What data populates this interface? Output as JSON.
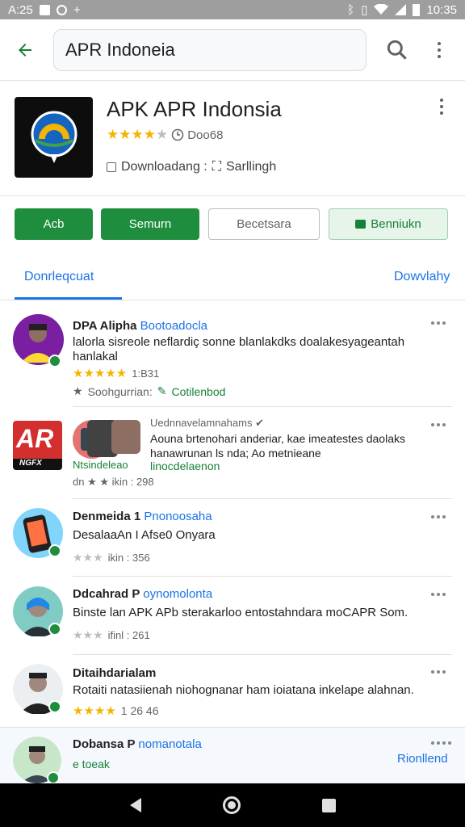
{
  "status_bar": {
    "time_left": "A:25",
    "time_right": "10:35"
  },
  "search": {
    "query": "APR Indoneia"
  },
  "app": {
    "title": "APK APR Indonsia",
    "rating_count": "Doo68",
    "download_label": "Downloadang :",
    "developer": "Sarllingh"
  },
  "buttons": {
    "b1": "Acb",
    "b2": "Semurn",
    "b3": "Becetsara",
    "b4": "Benniukn"
  },
  "tabs": {
    "left": "Donrleqcuat",
    "right": "Dowvlahy"
  },
  "reviews": [
    {
      "name": "DPA Alipha",
      "sub": "Bootoadocla",
      "text": "lalorla sisreole neflardiç sonne blanlakdks doalakesyageantah hanlakal",
      "stars_text": "1:B31",
      "meta_label": "Soohgurrian:",
      "meta_link": "Cotilenbod"
    },
    {
      "name": "Uednnavelamnahams",
      "logo_text": "AR",
      "logo_sub": "NGFX",
      "left_label": "Ntsindeleao",
      "text": "Aouna brtenohari anderiar, kae imeatestes daolaks hanawrunan ls nda; Ao metnieane",
      "link": "linocdelaenon",
      "meta": "dn ★ ★ ikin : 298"
    },
    {
      "name": "Denmeida 1",
      "sub": "Pnonoosaha",
      "text": "DesalaaAn I Afse0 Onyara",
      "meta": "ikin : 356"
    },
    {
      "name": "Ddcahrad P",
      "sub": "oynomolonta",
      "text": "Binste lan APK APb sterakarloo entostahndara moCAPR Som.",
      "meta": "ifinl : 261"
    },
    {
      "name": "Ditaihdarialam",
      "text": "Rotaiti natasiienah niohognanar ham ioiatana inkelape alahnan.",
      "meta": "1 26 46"
    },
    {
      "name": "Dobansa P",
      "sub": "nomanotala",
      "meta_link": "e toeak",
      "right_link": "Rionllend"
    }
  ],
  "colors": {
    "accent_green": "#1e8e3e",
    "accent_blue": "#1a73e8",
    "star": "#f4b400"
  }
}
